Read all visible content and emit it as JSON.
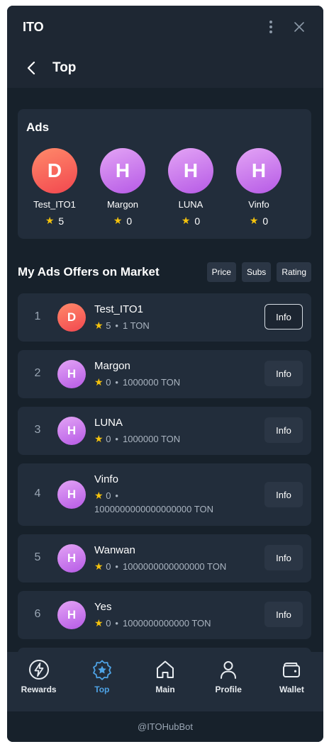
{
  "titlebar": {
    "title": "ITO",
    "menu_icon": "more-vertical-icon",
    "close_icon": "close-icon"
  },
  "navbar": {
    "back_icon": "chevron-left-icon",
    "title": "Top"
  },
  "ads": {
    "title": "Ads",
    "items": [
      {
        "initial": "D",
        "name": "Test_ITO1",
        "rating": "5",
        "color": "#f55a5a"
      },
      {
        "initial": "H",
        "name": "Margon",
        "rating": "0",
        "color": "#c77ded"
      },
      {
        "initial": "H",
        "name": "LUNA",
        "rating": "0",
        "color": "#c77ded"
      },
      {
        "initial": "H",
        "name": "Vinfo",
        "rating": "0",
        "color": "#c77ded"
      }
    ]
  },
  "offers": {
    "title": "My Ads Offers on Market",
    "sort_buttons": [
      "Price",
      "Subs",
      "Rating"
    ],
    "rows": [
      {
        "rank": "1",
        "initial": "D",
        "name": "Test_ITO1",
        "rating": "5",
        "price": "1 TON",
        "info_label": "Info"
      },
      {
        "rank": "2",
        "initial": "H",
        "name": "Margon",
        "rating": "0",
        "price": "1000000 TON",
        "info_label": "Info"
      },
      {
        "rank": "3",
        "initial": "H",
        "name": "LUNA",
        "rating": "0",
        "price": "1000000 TON",
        "info_label": "Info"
      },
      {
        "rank": "4",
        "initial": "H",
        "name": "Vinfo",
        "rating": "0",
        "price": "1000000000000000000 TON",
        "info_label": "Info"
      },
      {
        "rank": "5",
        "initial": "H",
        "name": "Wanwan",
        "rating": "0",
        "price": "1000000000000000 TON",
        "info_label": "Info"
      },
      {
        "rank": "6",
        "initial": "H",
        "name": "Yes",
        "rating": "0",
        "price": "1000000000000 TON",
        "info_label": "Info"
      }
    ]
  },
  "tabs": [
    {
      "label": "Rewards",
      "icon": "lightning-icon"
    },
    {
      "label": "Top",
      "icon": "star-badge-icon"
    },
    {
      "label": "Main",
      "icon": "home-icon"
    },
    {
      "label": "Profile",
      "icon": "user-icon"
    },
    {
      "label": "Wallet",
      "icon": "wallet-icon"
    }
  ],
  "footer": {
    "bot_name": "@ITOHubBot"
  },
  "colors": {
    "background": "#17212b",
    "card": "#222d3b",
    "accent": "#4ea3e6",
    "star": "#f4c20d"
  }
}
